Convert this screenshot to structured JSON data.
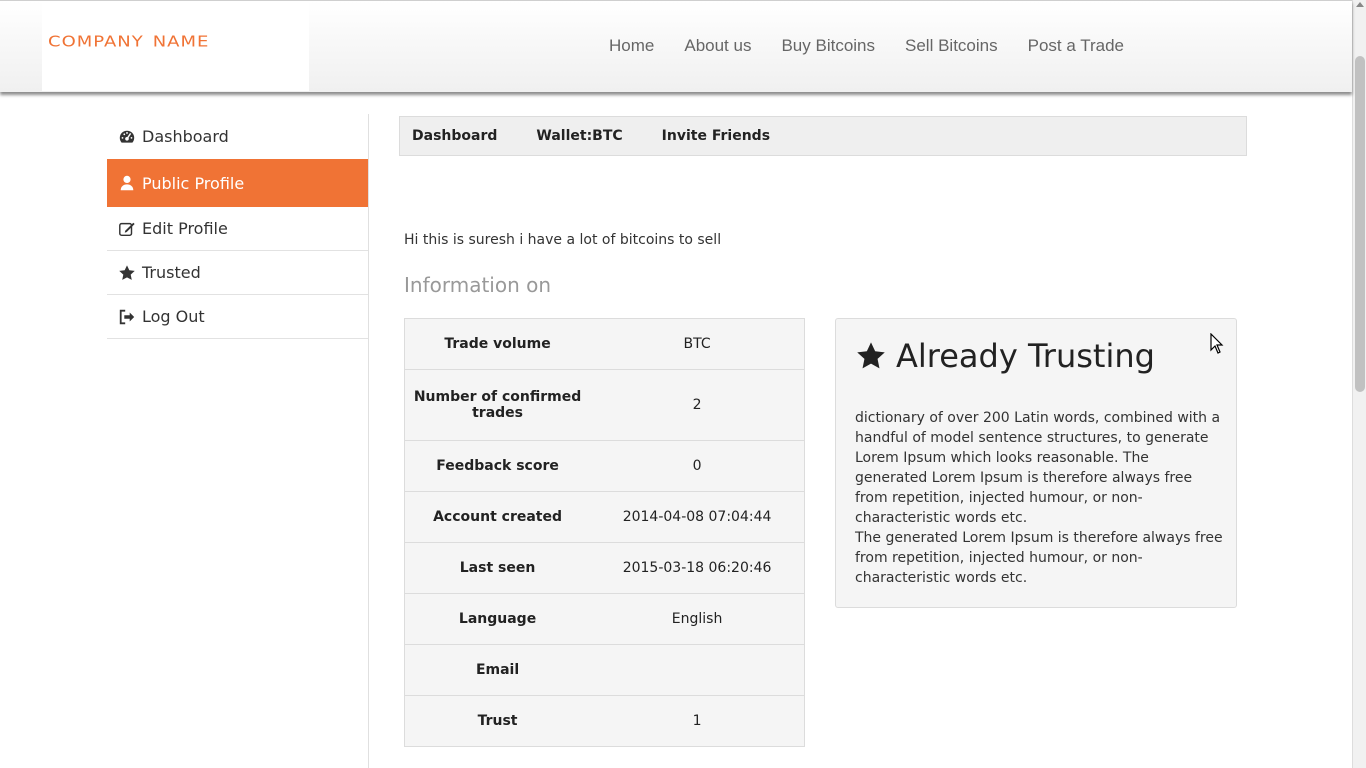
{
  "header": {
    "logo_text": "company name",
    "nav": [
      "Home",
      "About us",
      "Buy Bitcoins",
      "Sell Bitcoins",
      "Post a Trade"
    ]
  },
  "sidebar": {
    "items": [
      {
        "label": "Dashboard",
        "icon": "dashboard-icon",
        "active": false
      },
      {
        "label": "Public Profile",
        "icon": "user-icon",
        "active": true
      },
      {
        "label": "Edit Profile",
        "icon": "edit-icon",
        "active": false
      },
      {
        "label": "Trusted",
        "icon": "star-icon",
        "active": false
      },
      {
        "label": "Log Out",
        "icon": "logout-icon",
        "active": false
      }
    ]
  },
  "subnav": [
    "Dashboard",
    "Wallet:BTC",
    "Invite Friends"
  ],
  "profile": {
    "bio": "Hi this is suresh i have a lot of bitcoins to sell",
    "info_heading": "Information on",
    "rows": [
      {
        "label": "Trade volume",
        "value": "BTC"
      },
      {
        "label": "Number of confirmed trades",
        "value": "2"
      },
      {
        "label": "Feedback score",
        "value": "0"
      },
      {
        "label": "Account created",
        "value": "2014-04-08 07:04:44"
      },
      {
        "label": "Last seen",
        "value": "2015-03-18 06:20:46"
      },
      {
        "label": "Language",
        "value": "English"
      },
      {
        "label": "Email",
        "value": ""
      },
      {
        "label": "Trust",
        "value": "1"
      }
    ]
  },
  "trust_box": {
    "title": "Already Trusting",
    "text": "dictionary of over 200 Latin words, combined with a handful of model sentence structures, to generate Lorem Ipsum which looks reasonable. The generated Lorem Ipsum is therefore always free from repetition, injected humour, or non-characteristic words etc.\nThe generated Lorem Ipsum is therefore always free from repetition, injected humour, or non-characteristic words etc."
  },
  "colors": {
    "accent": "#f07335",
    "panel_bg": "#f5f5f5"
  }
}
